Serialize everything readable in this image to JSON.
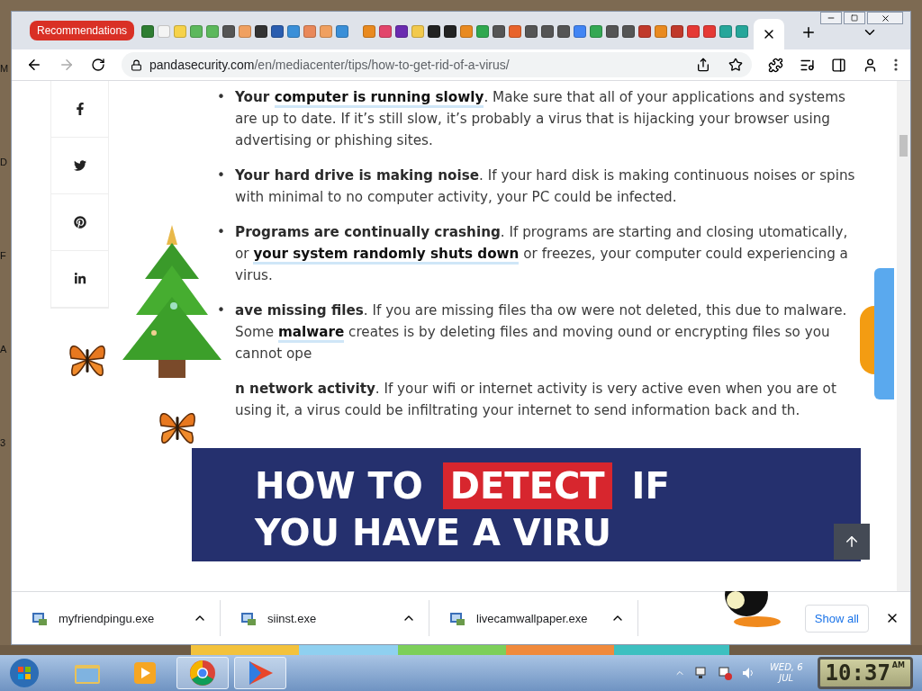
{
  "desktop_labels": [
    "M",
    "D",
    "F",
    "A",
    "3"
  ],
  "tab_strip": {
    "group_label": "Recommendations",
    "favicons": [
      {
        "color": "#2e7d32"
      },
      {
        "color": "#f4f4f4"
      },
      {
        "color": "#f6d24a"
      },
      {
        "color": "#5cb85c"
      },
      {
        "color": "#5cb85c"
      },
      {
        "color": "#555555"
      },
      {
        "color": "#f0a060"
      },
      {
        "color": "#333333"
      },
      {
        "color": "#2a5db0"
      },
      {
        "color": "#3a8fd8"
      },
      {
        "color": "#e9885a"
      },
      {
        "color": "#f0a060"
      },
      {
        "color": "#3a8fd8"
      },
      {
        "color": "#e98a20"
      },
      {
        "color": "#e2456b"
      },
      {
        "color": "#6a2bb0"
      },
      {
        "color": "#f2c94c"
      },
      {
        "color": "#222222"
      },
      {
        "color": "#222222"
      },
      {
        "color": "#e98a20"
      },
      {
        "color": "#2fa84f"
      },
      {
        "color": "#555555"
      },
      {
        "color": "#e8632b"
      },
      {
        "color": "#555555"
      },
      {
        "color": "#555555"
      },
      {
        "color": "#555555"
      },
      {
        "color": "#4285f4"
      },
      {
        "color": "#34a853"
      },
      {
        "color": "#555555"
      },
      {
        "color": "#555555"
      },
      {
        "color": "#c0392b"
      },
      {
        "color": "#e98a20"
      },
      {
        "color": "#c0392b"
      },
      {
        "color": "#e53935"
      },
      {
        "color": "#e53935"
      },
      {
        "color": "#26a69a"
      },
      {
        "color": "#26a69a"
      }
    ]
  },
  "address": {
    "host": "pandasecurity.com",
    "path": "/en/mediacenter/tips/how-to-get-rid-of-a-virus/"
  },
  "article": {
    "items": [
      {
        "marker": "•",
        "segments": [
          {
            "text": "Your ",
            "kind": "bold"
          },
          {
            "text": "computer is running slowly",
            "kind": "link"
          },
          {
            "text": ". Make sure that all of your applications and systems are up to date. If it’s still slow, it’s probably a virus that is hijacking your browser using advertising or phishing sites.",
            "kind": "plain"
          }
        ]
      },
      {
        "marker": "•",
        "segments": [
          {
            "text": "Your hard drive is making noise",
            "kind": "bold"
          },
          {
            "text": ". If your hard disk is making continuous noises or spins with minimal to no computer activity, your PC could be infected.",
            "kind": "plain"
          }
        ]
      },
      {
        "marker": "•",
        "segments": [
          {
            "text": "Programs are continually crashing",
            "kind": "bold"
          },
          {
            "text": ". If programs are starting and closing utomatically, or ",
            "kind": "plain"
          },
          {
            "text": "your system randomly shuts down",
            "kind": "link"
          },
          {
            "text": " or freezes, your computer could experiencing a virus.",
            "kind": "plain"
          }
        ]
      },
      {
        "marker": "•",
        "segments": [
          {
            "text": "ave missing files",
            "kind": "bold"
          },
          {
            "text": ". If you are missing files tha ow were not deleted, this due to malware. Some ",
            "kind": "plain"
          },
          {
            "text": "malware",
            "kind": "link"
          },
          {
            "text": " creates is by deleting files and moving ound or encrypting files so you cannot ope",
            "kind": "plain"
          }
        ]
      },
      {
        "segments": [
          {
            "text": "n network activity",
            "kind": "bold"
          },
          {
            "text": ". If your wifi or internet activity is very active even when you are ot using it, a virus could be infiltrating your internet to send information back and th.",
            "kind": "plain"
          }
        ]
      }
    ]
  },
  "banner": {
    "line_1": [
      {
        "text": "HOW TO",
        "kind": "plain"
      },
      {
        "text": "DETECT",
        "kind": "highlight"
      },
      {
        "text": "IF",
        "kind": "plain"
      }
    ],
    "line_2": "YOU HAVE A VIRU"
  },
  "downloads": {
    "items": [
      {
        "name": "myfriendpingu.exe"
      },
      {
        "name": "siinst.exe"
      },
      {
        "name": "livecamwallpaper.exe"
      }
    ],
    "show_all": "Show all"
  },
  "taskbar": {
    "apps": [
      {
        "kind": "explorer",
        "running": false
      },
      {
        "kind": "media",
        "running": false
      },
      {
        "kind": "chrome",
        "running": true
      },
      {
        "kind": "player",
        "running": true
      }
    ],
    "date_line_1": "WED, 6",
    "date_line_2": "JUL",
    "clock": "10:37",
    "ampm": "AM"
  }
}
